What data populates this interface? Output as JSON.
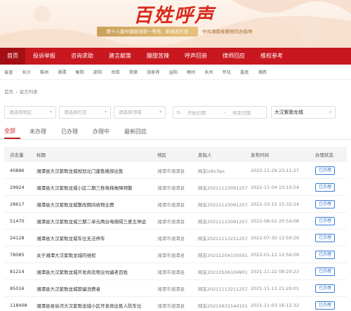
{
  "banner": {
    "logo_text": "百姓呼声",
    "award_text": "第十八届中国新闻奖一等奖、新闻名栏目",
    "guide_text": "中共湖南省委网信办指导"
  },
  "nav": [
    "首页",
    "投诉举报",
    "咨询求助",
    "建言献策",
    "酸甜苦辣",
    "呼声回音",
    "律师回应",
    "维权参考"
  ],
  "cities": [
    "省直",
    "长沙",
    "株洲",
    "湘潭",
    "衡阳",
    "邵阳",
    "岳阳",
    "常德",
    "张家界",
    "益阳",
    "郴州",
    "永州",
    "怀化",
    "娄底",
    "湘西"
  ],
  "breadcrumb": {
    "home": "首页",
    "sep": "›",
    "current": "留言列表"
  },
  "filters": {
    "area_placeholder": "请选择地区",
    "column_placeholder": "请选择栏目",
    "domain_placeholder": "请选择领域",
    "start_date": "开始日期",
    "date_sep": "-",
    "end_date": "结束日期",
    "search_value": "大汉紫歌龙城"
  },
  "tabs": [
    "全部",
    "未办理",
    "已办理",
    "办理中",
    "最新回应"
  ],
  "table": {
    "headers": {
      "count": "点击量",
      "title": "标题",
      "area": "地区",
      "sender": "发贴人",
      "time": "发布时间",
      "status": "办理状态"
    },
    "rows": [
      {
        "count": "40896",
        "title": "湘潭县大汉紫歌龙城规划北门建售楼部出售",
        "area": "湘潭市湘潭县",
        "sender": "网友iz6v3ps",
        "time": "2022-11-29 23:11:27",
        "status": "已办理"
      },
      {
        "count": "29924",
        "title": "湘潭县大汉紫歌龙城小区二期三栋电梯故障频繁",
        "area": "湘潭市湘潭县",
        "sender": "网友20211123091257",
        "time": "2022-11-04 10:10:54",
        "status": "已办理"
      },
      {
        "count": "28617",
        "title": "湘潭县大汉紫歌龙城整改期间收物业费",
        "area": "湘潭市湘潭县",
        "sender": "网友20211123091257",
        "time": "2022-10-15 15:32:24",
        "status": "已办理"
      },
      {
        "count": "51470",
        "title": "湘潭县大汉紫歌龙城三期二单元两台电梯隔三差五停运",
        "area": "湘潭市湘潭县",
        "sender": "网友20211123091257",
        "time": "2022-08-02 20:54:08",
        "status": "已办理"
      },
      {
        "count": "24128",
        "title": "湘潭县大汉紫歌龙城车位无法停车",
        "area": "湘潭市湘潭县",
        "sender": "网友20211113211257",
        "time": "2022-07-30 12:59:26",
        "status": "已办理"
      },
      {
        "count": "78085",
        "title": "关于湘潭大汉紫歌龙城的维权",
        "area": "湘潭市湘潭县",
        "sender": "网友20211204150501",
        "time": "2022-01-12 12:56:09",
        "status": "已办理"
      },
      {
        "count": "81214",
        "title": "湘潭县大汉紫歌龙城开发商及物业坑骗老百姓",
        "area": "湘潭市湘潭县",
        "sender": "网友20210506104901",
        "time": "2021-11-22 08:20:23",
        "status": "已办理"
      },
      {
        "count": "85016",
        "title": "湘潭县大汉紫歌龙城欺骗消费者",
        "area": "湘潭市湘潭县",
        "sender": "网友20211113211257",
        "time": "2021-11-13 21:20:01",
        "status": "已办理"
      },
      {
        "count": "118408",
        "title": "湘潭县易俗河大汉紫歌龙城小区开发商出售人防车位",
        "area": "湘潭市湘潭县",
        "sender": "网友20210931544101",
        "time": "2021-11-03 16:12:32",
        "status": "已办理"
      }
    ]
  },
  "colors": {
    "brand_red": "#c8171e",
    "link_blue": "#3a7bd5",
    "gold": "#c9a15a"
  }
}
